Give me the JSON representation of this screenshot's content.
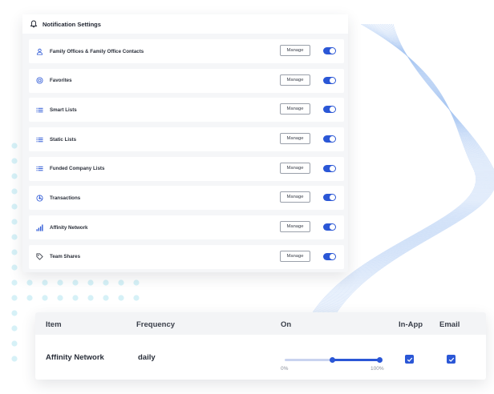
{
  "settings": {
    "title": "Notification Settings",
    "header_icon": "bell-icon",
    "manage_label": "Manage",
    "items": [
      {
        "label": "Family Offices & Family Office Contacts",
        "icon": "user-icon",
        "enabled": true
      },
      {
        "label": "Favorites",
        "icon": "star-circle-icon",
        "enabled": true
      },
      {
        "label": "Smart Lists",
        "icon": "list-icon",
        "enabled": true
      },
      {
        "label": "Static Lists",
        "icon": "list-icon",
        "enabled": true
      },
      {
        "label": "Funded Company Lists",
        "icon": "list-icon",
        "enabled": true
      },
      {
        "label": "Transactions",
        "icon": "transactions-icon",
        "enabled": true
      },
      {
        "label": "Affinity Network",
        "icon": "bar-chart-icon",
        "enabled": true
      },
      {
        "label": "Team Shares",
        "icon": "tag-icon",
        "enabled": true
      }
    ]
  },
  "preferences": {
    "columns": {
      "item": "Item",
      "frequency": "Frequency",
      "on": "On",
      "in_app": "In-App",
      "email": "Email"
    },
    "rows": [
      {
        "item": "Affinity Network",
        "frequency": "daily",
        "range_min_label": "0%",
        "range_max_label": "100%",
        "range_low": 0.5,
        "range_high": 1.0,
        "in_app": true,
        "email": true
      }
    ]
  },
  "colors": {
    "accent": "#2b57d6",
    "track": "#c9d3ef",
    "dots": "#d6f1f7",
    "wave": "#a9c8f2"
  }
}
